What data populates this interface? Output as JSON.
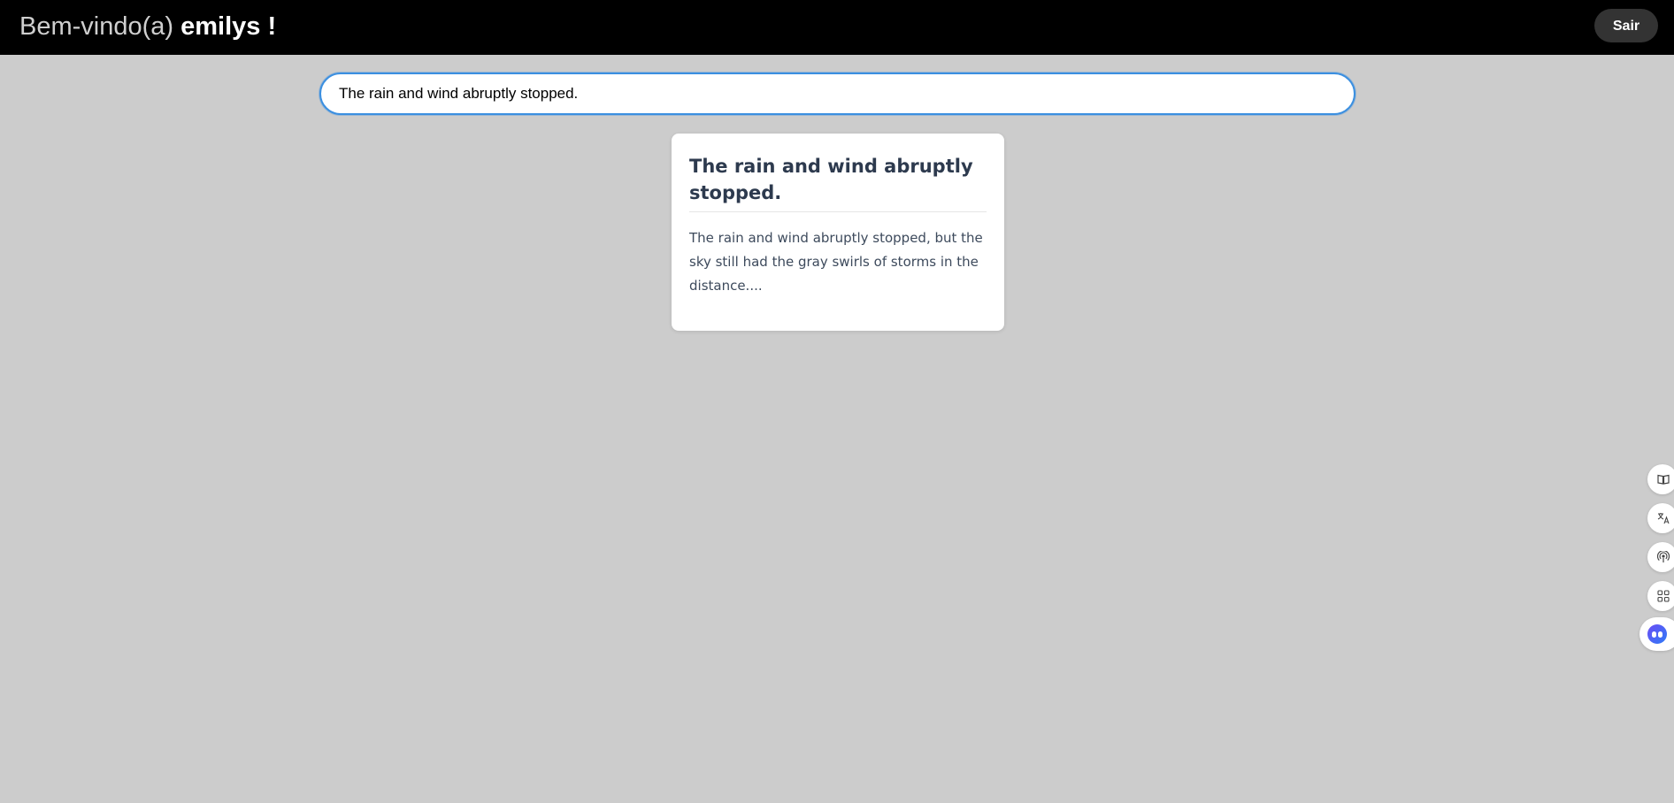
{
  "header": {
    "greeting": "Bem-vindo(a)",
    "username": "emilys",
    "exclamation": " !",
    "logout_label": "Sair"
  },
  "search": {
    "value": "The rain and wind abruptly stopped.",
    "placeholder": ""
  },
  "results": [
    {
      "title": "The rain and wind abruptly stopped.",
      "excerpt": "The rain and wind abruptly stopped, but the sky still had the gray swirls of storms in the distance...."
    }
  ],
  "side_toolbar": {
    "items": [
      {
        "icon": "book-icon"
      },
      {
        "icon": "translate-icon"
      },
      {
        "icon": "broadcast-icon"
      },
      {
        "icon": "apps-grid-icon"
      }
    ],
    "assistant_icon": "assistant-face-icon"
  },
  "colors": {
    "background": "#cccccc",
    "topbar": "#000000",
    "focus_ring": "#3b8fe0",
    "title_text": "#2d3a4e"
  }
}
